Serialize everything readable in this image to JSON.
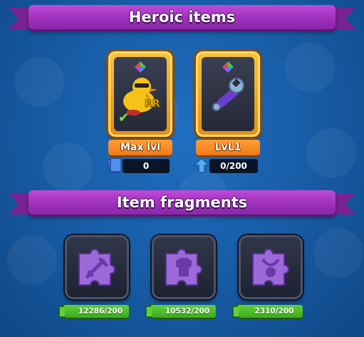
{
  "heroic": {
    "title": "Heroic items",
    "items": [
      {
        "level_label": "Max lvl",
        "count": "0",
        "icon": "card-icon"
      },
      {
        "level_label": "LvL1",
        "count": "0/200",
        "icon": "upgrade-arrow-icon"
      }
    ]
  },
  "fragments": {
    "title": "Item fragments",
    "items": [
      {
        "count": "12286/200",
        "icon": "weapon-fragment-icon"
      },
      {
        "count": "10532/200",
        "icon": "armor-fragment-icon"
      },
      {
        "count": "2310/200",
        "icon": "amulet-fragment-icon"
      }
    ]
  },
  "colors": {
    "background": "#175aa3",
    "banner": "#9b2fba",
    "hero_frame": "#f6c33a",
    "level_label": "#f07a14",
    "fragment_bar": "#3fa91f",
    "fragment_piece": "#9b6ad8"
  }
}
